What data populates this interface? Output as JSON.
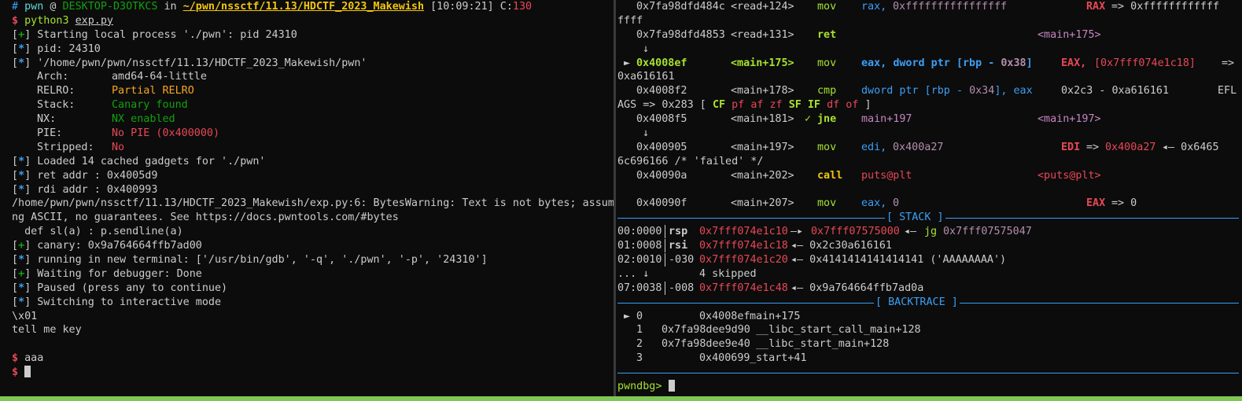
{
  "left": {
    "prompt": {
      "user": "pwn",
      "at": "@",
      "host": "DESKTOP-D3OTKCS",
      "in": "in",
      "path": "~/pwn/nssctf/11.13/HDCTF_2023_Makewish",
      "time": "[10:09:21]",
      "code_label": "C:",
      "code": "130"
    },
    "cmd": {
      "dollar": "$",
      "prog": "python3",
      "arg": "exp.py"
    },
    "l_start": {
      "tag": "+",
      "text": "Starting local process './pwn': pid 24310"
    },
    "l_pid": {
      "tag": "*",
      "text": "pid: 24310"
    },
    "l_path": {
      "tag": "*",
      "text": "'/home/pwn/pwn/nssctf/11.13/HDCTF_2023_Makewish/pwn'"
    },
    "checksec": [
      {
        "k": "Arch:",
        "v": "amd64-64-little"
      },
      {
        "k": "RELRO:",
        "v": "Partial RELRO"
      },
      {
        "k": "Stack:",
        "v": "Canary found"
      },
      {
        "k": "NX:",
        "v": "NX enabled"
      },
      {
        "k": "PIE:",
        "v": "No PIE (0x400000)"
      },
      {
        "k": "Stripped:",
        "v": "No"
      }
    ],
    "l_gadgets": {
      "tag": "*",
      "text": "Loaded 14 cached gadgets for './pwn'"
    },
    "l_ret": {
      "tag": "*",
      "text": "ret addr : 0x4005d9"
    },
    "l_rdi": {
      "tag": "*",
      "text": "rdi addr : 0x400993"
    },
    "warn1": "/home/pwn/pwn/nssctf/11.13/HDCTF_2023_Makewish/exp.py:6: BytesWarning: Text is not bytes; assumi",
    "warn2": "ng ASCII, no guarantees. See https://docs.pwntools.com/#bytes",
    "warn3": "  def sl(a) : p.sendline(a)",
    "l_canary": {
      "tag": "+",
      "text": "canary: 0x9a764664ffb7ad00"
    },
    "l_term": {
      "tag": "*",
      "text": "running in new terminal: ['/usr/bin/gdb', '-q', './pwn', '-p', '24310']"
    },
    "l_wait": {
      "tag": "+",
      "text": "Waiting for debugger: Done"
    },
    "l_paused": {
      "tag": "*",
      "text": "Paused (press any to continue)"
    },
    "l_inter": {
      "tag": "*",
      "text": "Switching to interactive mode"
    },
    "out1": "\\x01",
    "out2": "tell me key",
    "in1": {
      "dollar": "$",
      "text": "aaa"
    },
    "in2": {
      "dollar": "$"
    }
  },
  "right": {
    "d1": {
      "addr": "0x7fa98dfd484c",
      "sym": "<read+124>",
      "op": "mov",
      "a1": "rax,",
      "a2": "0xffffffffffffffff",
      "c1": "RAX",
      "c2": "=> 0xffffffffffff"
    },
    "d1b": "ffff",
    "d2": {
      "addr": "0x7fa98dfd4853",
      "sym": "<read+131>",
      "op": "ret",
      "tgt": "<main+175>"
    },
    "arrow": "↓",
    "d3": {
      "mark": "►",
      "addr": "0x4008ef",
      "sym": "<main+175>",
      "op": "mov",
      "a1": "eax,",
      "a2": "dword ptr",
      "a3": "[",
      "a4": "rbp",
      "a5": "-",
      "a6": "0x38",
      "a7": "]",
      "c1": "EAX,",
      "c2": "[0x7fff074e1c18]",
      "c3": "=>"
    },
    "d3b": "0xa616161",
    "d4": {
      "addr": "0x4008f2",
      "sym": "<main+178>",
      "op": "cmp",
      "a1": "dword ptr",
      "a2": "[",
      "a3": "rbp",
      "a4": "-",
      "a5": "0x34",
      "a6": "], eax",
      "c1": "0x2c3 - 0xa616161",
      "c2": "EFL"
    },
    "d4b": {
      "t1": "AGS => 0x283 [",
      "f1": "CF",
      "f2": "pf",
      "f3": "af",
      "f4": "zf",
      "f5": "SF",
      "f6": "IF",
      "f7": "df",
      "f8": "of",
      "t2": "]"
    },
    "d5": {
      "addr": "0x4008f5",
      "sym": "<main+181>",
      "check": "✓",
      "op": "jne",
      "a1": "main+197",
      "tgt": "<main+197>"
    },
    "d6": {
      "addr": "0x400905",
      "sym": "<main+197>",
      "op": "mov",
      "a1": "edi,",
      "a2": "0x400a27",
      "c1": "EDI",
      "c2": "=>",
      "c3": "0x400a27",
      "c4": "◂— 0x6465"
    },
    "d6b": "6c696166 /* 'failed' */",
    "d7": {
      "addr": "0x40090a",
      "sym": "<main+202>",
      "op": "call",
      "a1": "puts@plt",
      "tgt": "<puts@plt>"
    },
    "d8": {
      "addr": "0x40090f",
      "sym": "<main+207>",
      "op": "mov",
      "a1": "eax,",
      "a2": "0",
      "c1": "EAX",
      "c2": "=> 0"
    },
    "stack_header": "[ STACK ]",
    "stack": [
      {
        "off": "00:0000",
        "reg": "rsp",
        "addr": "0x7fff074e1c10",
        "rest1": "—▸",
        "v1": "0x7fff07575000",
        "rest2": "◂—",
        "v2": "jg",
        "v3": "0x7fff07575047"
      },
      {
        "off": "01:0008",
        "reg": "rsi",
        "addr": "0x7fff074e1c18",
        "rest1": "◂— 0x2c30a616161"
      },
      {
        "off": "02:0010",
        "reg": "-030",
        "addr": "0x7fff074e1c20",
        "rest1": "◂— 0x4141414141414141 ('AAAAAAAA')"
      },
      {
        "off": "... ↓",
        "reg": "",
        "addr": "",
        "rest1": "4 skipped"
      },
      {
        "off": "07:0038",
        "reg": "-008",
        "addr": "0x7fff074e1c48",
        "rest1": "◂— 0x9a764664ffb7ad0a"
      }
    ],
    "bt_header": "[ BACKTRACE ]",
    "backtrace": [
      {
        "mark": "►",
        "idx": "0",
        "addr": "0x4008ef",
        "sym": "main+175"
      },
      {
        "mark": "",
        "idx": "1",
        "addr": "0x7fa98dee9d90",
        "sym": "__libc_start_call_main+128"
      },
      {
        "mark": "",
        "idx": "2",
        "addr": "0x7fa98dee9e40",
        "sym": "__libc_start_main+128"
      },
      {
        "mark": "",
        "idx": "3",
        "addr": "0x400699",
        "sym": "_start+41"
      }
    ],
    "pwndbg_prompt": "pwndbg>"
  }
}
